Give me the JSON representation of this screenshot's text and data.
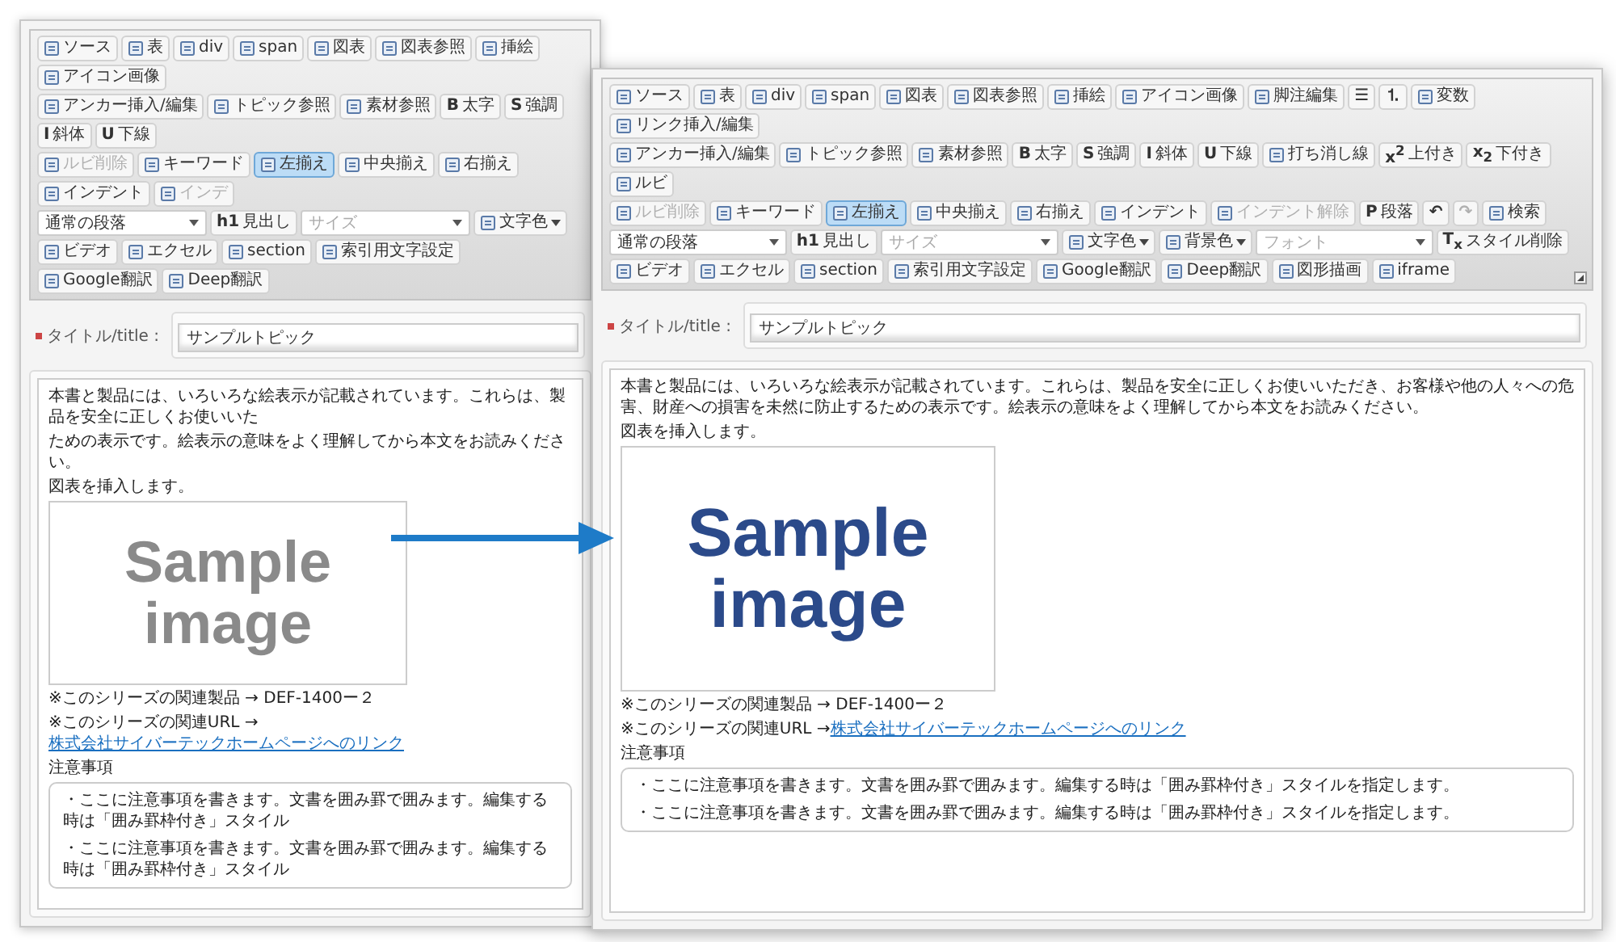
{
  "windows": [
    {
      "toolbar": {
        "rows": [
          {
            "items": [
              {
                "kind": "button",
                "label": "ソース",
                "selected": false,
                "disabled": false
              },
              {
                "kind": "button",
                "label": "表",
                "selected": false,
                "disabled": false
              },
              {
                "kind": "button",
                "label": "div",
                "selected": false,
                "disabled": false
              },
              {
                "kind": "button",
                "label": "span",
                "selected": false,
                "disabled": false
              },
              {
                "kind": "button",
                "label": "図表",
                "selected": false,
                "disabled": false
              },
              {
                "kind": "button",
                "label": "図表参照",
                "selected": false,
                "disabled": false
              },
              {
                "kind": "button",
                "label": "挿絵",
                "selected": false,
                "disabled": false
              },
              {
                "kind": "button",
                "label": "アイコン画像",
                "selected": false,
                "disabled": false
              }
            ]
          },
          {
            "items": [
              {
                "kind": "button",
                "label": "アンカー挿入/編集",
                "selected": false,
                "disabled": false
              },
              {
                "kind": "button",
                "label": "トピック参照",
                "selected": false,
                "disabled": false
              },
              {
                "kind": "button",
                "label": "素材参照",
                "selected": false,
                "disabled": false
              },
              {
                "kind": "button",
                "glyph": "B",
                "label": "太字",
                "selected": false,
                "disabled": false
              },
              {
                "kind": "button",
                "glyph": "S",
                "label": "強調",
                "selected": false,
                "disabled": false
              },
              {
                "kind": "button",
                "glyph": "I",
                "label": "斜体",
                "selected": false,
                "disabled": false
              },
              {
                "kind": "button",
                "glyph": "U",
                "label": "下線",
                "selected": false,
                "disabled": false
              }
            ]
          },
          {
            "items": [
              {
                "kind": "button",
                "label": "ルビ削除",
                "selected": false,
                "disabled": true
              },
              {
                "kind": "button",
                "label": "キーワード",
                "selected": false,
                "disabled": false
              },
              {
                "kind": "button",
                "label": "左揃え",
                "selected": true,
                "disabled": false
              },
              {
                "kind": "button",
                "label": "中央揃え",
                "selected": false,
                "disabled": false
              },
              {
                "kind": "button",
                "label": "右揃え",
                "selected": false,
                "disabled": false
              },
              {
                "kind": "button",
                "label": "インデント",
                "selected": false,
                "disabled": false
              },
              {
                "kind": "button",
                "label": "インデ",
                "selected": false,
                "disabled": true
              }
            ]
          },
          {
            "items": [
              {
                "kind": "select",
                "value": "通常の段落"
              },
              {
                "kind": "button",
                "glyph": "h1",
                "label": "見出し",
                "selected": false,
                "disabled": false
              },
              {
                "kind": "select",
                "placeholder": "サイズ"
              },
              {
                "kind": "button",
                "label": "文字色",
                "caret": true,
                "selected": false,
                "disabled": false
              }
            ]
          },
          {
            "items": [
              {
                "kind": "button",
                "label": "ビデオ",
                "selected": false,
                "disabled": false
              },
              {
                "kind": "button",
                "label": "エクセル",
                "selected": false,
                "disabled": false
              },
              {
                "kind": "button",
                "label": "section",
                "selected": false,
                "disabled": false
              },
              {
                "kind": "button",
                "label": "索引用文字設定",
                "selected": false,
                "disabled": false
              },
              {
                "kind": "button",
                "label": "Google翻訳",
                "selected": false,
                "disabled": false
              },
              {
                "kind": "button",
                "label": "Deep翻訳",
                "selected": false,
                "disabled": false
              }
            ]
          }
        ]
      },
      "title_label": "タイトル/title :",
      "title_value": "サンプルトピック",
      "body": {
        "paragraphs": [
          "本書と製品には、いろいろな絵表示が記載されています。これらは、製品を安全に正しくお使いいた",
          "ための表示です。絵表示の意味をよく理解してから本文をお読みください。",
          "図表を挿入します。"
        ],
        "image": {
          "text": "Sample image",
          "color": "#8a8a8a"
        },
        "related": "※このシリーズの関連製品 → DEF-1400ー２",
        "url_prefix": "※このシリーズの関連URL → ",
        "url_link": "株式会社サイバーテックホームページへのリンク",
        "notes_heading": "注意事項",
        "notes": [
          "・ここに注意事項を書きます。文書を囲み罫で囲みます。編集する時は「囲み罫枠付き」スタイル",
          "・ここに注意事項を書きます。文書を囲み罫で囲みます。編集する時は「囲み罫枠付き」スタイル"
        ]
      }
    },
    {
      "toolbar": {
        "rows": [
          {
            "items": [
              {
                "kind": "button",
                "label": "ソース",
                "selected": false,
                "disabled": false
              },
              {
                "kind": "button",
                "label": "表",
                "selected": false,
                "disabled": false
              },
              {
                "kind": "button",
                "label": "div",
                "selected": false,
                "disabled": false
              },
              {
                "kind": "button",
                "label": "span",
                "selected": false,
                "disabled": false
              },
              {
                "kind": "button",
                "label": "図表",
                "selected": false,
                "disabled": false
              },
              {
                "kind": "button",
                "label": "図表参照",
                "selected": false,
                "disabled": false
              },
              {
                "kind": "button",
                "label": "挿絵",
                "selected": false,
                "disabled": false
              },
              {
                "kind": "button",
                "label": "アイコン画像",
                "selected": false,
                "disabled": false
              },
              {
                "kind": "button",
                "label": "脚注編集",
                "selected": false,
                "disabled": false
              },
              {
                "kind": "button",
                "glyph": "☰",
                "selected": false,
                "disabled": false
              },
              {
                "kind": "button",
                "glyph": "⒈",
                "selected": false,
                "disabled": false
              },
              {
                "kind": "button",
                "label": "変数",
                "selected": false,
                "disabled": false
              },
              {
                "kind": "button",
                "label": "リンク挿入/編集",
                "selected": false,
                "disabled": false
              }
            ]
          },
          {
            "items": [
              {
                "kind": "button",
                "label": "アンカー挿入/編集",
                "selected": false,
                "disabled": false
              },
              {
                "kind": "button",
                "label": "トピック参照",
                "selected": false,
                "disabled": false
              },
              {
                "kind": "button",
                "label": "素材参照",
                "selected": false,
                "disabled": false
              },
              {
                "kind": "button",
                "glyph": "B",
                "label": "太字",
                "selected": false,
                "disabled": false
              },
              {
                "kind": "button",
                "glyph": "S",
                "label": "強調",
                "selected": false,
                "disabled": false
              },
              {
                "kind": "button",
                "glyph": "I",
                "label": "斜体",
                "selected": false,
                "disabled": false
              },
              {
                "kind": "button",
                "glyph": "U",
                "label": "下線",
                "selected": false,
                "disabled": false
              },
              {
                "kind": "button",
                "label": "打ち消し線",
                "selected": false,
                "disabled": false
              },
              {
                "kind": "button",
                "glyph": "x$^{2}$",
                "label": "上付き",
                "selected": false,
                "disabled": false
              },
              {
                "kind": "button",
                "glyph": "x$_{2}$",
                "label": "下付き",
                "selected": false,
                "disabled": false
              },
              {
                "kind": "button",
                "label": "ルビ",
                "selected": false,
                "disabled": false
              }
            ]
          },
          {
            "items": [
              {
                "kind": "button",
                "label": "ルビ削除",
                "selected": false,
                "disabled": true
              },
              {
                "kind": "button",
                "label": "キーワード",
                "selected": false,
                "disabled": false
              },
              {
                "kind": "button",
                "label": "左揃え",
                "selected": true,
                "disabled": false
              },
              {
                "kind": "button",
                "label": "中央揃え",
                "selected": false,
                "disabled": false
              },
              {
                "kind": "button",
                "label": "右揃え",
                "selected": false,
                "disabled": false
              },
              {
                "kind": "button",
                "label": "インデント",
                "selected": false,
                "disabled": false
              },
              {
                "kind": "button",
                "label": "インデント解除",
                "selected": false,
                "disabled": true
              },
              {
                "kind": "button",
                "glyph": "P",
                "label": "段落",
                "selected": false,
                "disabled": false
              },
              {
                "kind": "button",
                "glyph": "↶",
                "selected": false,
                "disabled": false
              },
              {
                "kind": "button",
                "glyph": "↷",
                "selected": false,
                "disabled": true
              },
              {
                "kind": "button",
                "label": "検索",
                "selected": false,
                "disabled": false
              }
            ]
          },
          {
            "items": [
              {
                "kind": "select",
                "value": "通常の段落"
              },
              {
                "kind": "button",
                "glyph": "h1",
                "label": "見出し",
                "selected": false,
                "disabled": false
              },
              {
                "kind": "select",
                "placeholder": "サイズ"
              },
              {
                "kind": "button",
                "label": "文字色",
                "caret": true,
                "selected": false,
                "disabled": false
              },
              {
                "kind": "button",
                "label": "背景色",
                "caret": true,
                "selected": false,
                "disabled": false
              },
              {
                "kind": "select",
                "placeholder": "フォント"
              },
              {
                "kind": "button",
                "glyph": "T$_{x}$",
                "label": "スタイル削除",
                "selected": false,
                "disabled": false
              }
            ]
          },
          {
            "items": [
              {
                "kind": "button",
                "label": "ビデオ",
                "selected": false,
                "disabled": false
              },
              {
                "kind": "button",
                "label": "エクセル",
                "selected": false,
                "disabled": false
              },
              {
                "kind": "button",
                "label": "section",
                "selected": false,
                "disabled": false
              },
              {
                "kind": "button",
                "label": "索引用文字設定",
                "selected": false,
                "disabled": false
              },
              {
                "kind": "button",
                "label": "Google翻訳",
                "selected": false,
                "disabled": false
              },
              {
                "kind": "button",
                "label": "Deep翻訳",
                "selected": false,
                "disabled": false
              },
              {
                "kind": "button",
                "label": "図形描画",
                "selected": false,
                "disabled": false
              },
              {
                "kind": "button",
                "label": "iframe",
                "selected": false,
                "disabled": false
              }
            ]
          }
        ]
      },
      "title_label": "タイトル/title :",
      "title_value": "サンプルトピック",
      "body": {
        "paragraphs": [
          "本書と製品には、いろいろな絵表示が記載されています。これらは、製品を安全に正しくお使いいただき、お客様や他の人々への危害、財産への損害を未然に防止するための表示です。絵表示の意味をよく理解してから本文をお読みください。",
          "図表を挿入します。"
        ],
        "image": {
          "text": "Sample image",
          "color": "#2b4a8a"
        },
        "related": "※このシリーズの関連製品 → DEF-1400ー２",
        "url_prefix": "※このシリーズの関連URL → ",
        "url_link": "株式会社サイバーテックホームページへのリンク",
        "notes_heading": "注意事項",
        "notes": [
          "・ここに注意事項を書きます。文書を囲み罫で囲みます。編集する時は「囲み罫枠付き」スタイルを指定します。",
          "・ここに注意事項を書きます。文書を囲み罫で囲みます。編集する時は「囲み罫枠付き」スタイルを指定します。"
        ]
      }
    }
  ]
}
